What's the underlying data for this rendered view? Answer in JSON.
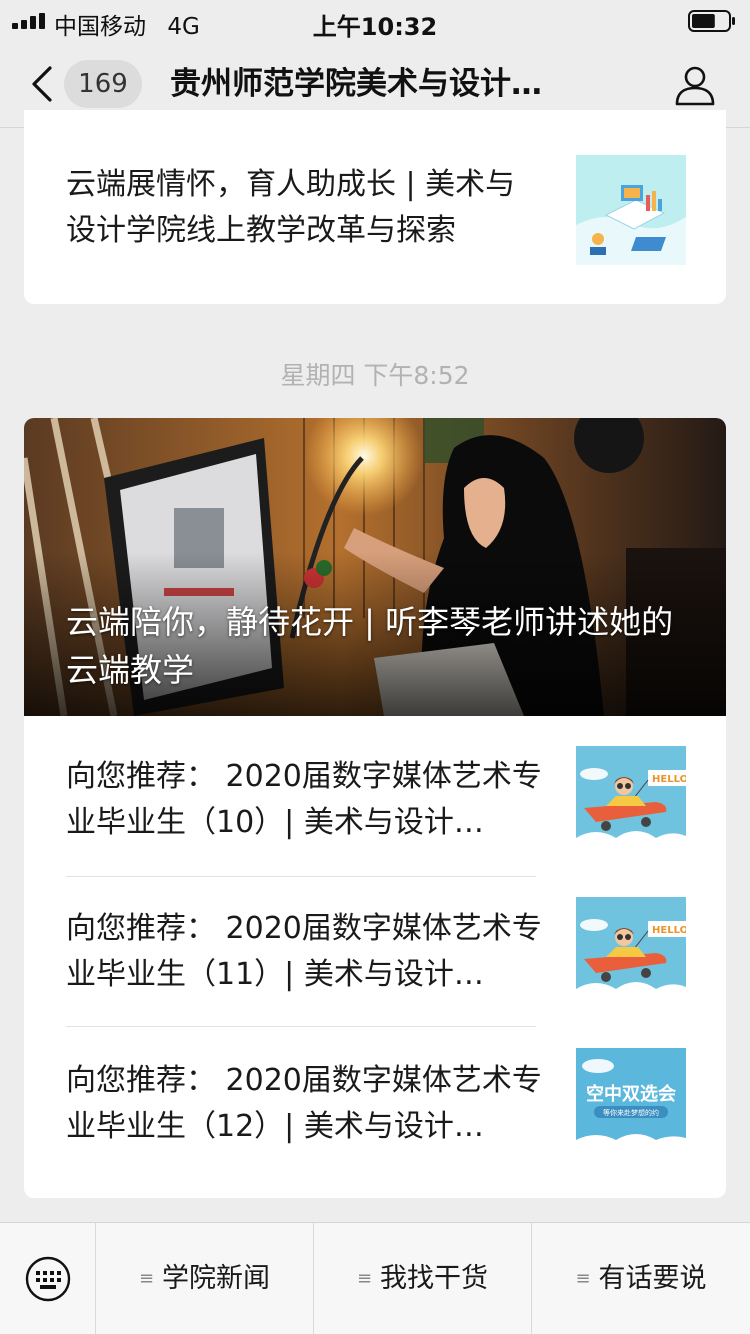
{
  "status_bar": {
    "carrier": "中国移动",
    "network": "4G",
    "time": "上午10:32",
    "battery_percent": 65
  },
  "nav": {
    "unread_count": "169",
    "title": "贵州师范学院美术与设计…",
    "icons": {
      "back": "chevron-left-icon",
      "profile": "person-icon"
    }
  },
  "articles_top": [
    {
      "title": "云端展情怀，育人助成长 | 美术与设计学院线上教学改革与探索",
      "thumb": "isometric-online-education-illustration"
    }
  ],
  "timestamp": "星期四 下午8:52",
  "articles_main": {
    "cover": {
      "title": "云端陪你，静待花开 | 听李琴老师讲述她的云端教学",
      "image": "teacher-at-monitor-with-desk-lamp-photo"
    },
    "items": [
      {
        "title": "向您推荐： 2020届数字媒体艺术专业毕业生（10）| 美术与设计…",
        "thumb": "pilot-airplane-hello-banner"
      },
      {
        "title": "向您推荐： 2020届数字媒体艺术专业毕业生（11）| 美术与设计…",
        "thumb": "pilot-airplane-hello-banner"
      },
      {
        "title": "向您推荐： 2020届数字媒体艺术专业毕业生（12）| 美术与设计…",
        "thumb": "sky-clouds-job-fair-poster"
      }
    ]
  },
  "thumb_text": {
    "hello": "HELLO",
    "job_fair": "空中双选会",
    "job_fair_sub": "等你来赴梦想的约"
  },
  "bottom_menu": {
    "keyboard_icon": "keyboard-icon",
    "items": [
      {
        "label": "学院新闻"
      },
      {
        "label": "我找干货"
      },
      {
        "label": "有话要说"
      }
    ]
  },
  "colors": {
    "background": "#ededed",
    "card": "#ffffff",
    "timestamp": "#b2b2b2"
  }
}
